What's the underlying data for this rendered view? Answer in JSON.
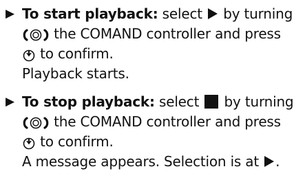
{
  "bullet_glyph": "▶",
  "items": [
    {
      "heading": "To start playback:",
      "text_a": " select ",
      "text_b": " by turning",
      "line2": " the COMAND controller and press",
      "line3": " to confirm.",
      "result": "Playback starts."
    },
    {
      "heading": "To stop playback:",
      "text_a": " select ",
      "text_b": " by turning",
      "line2": " the COMAND controller and press",
      "line3": " to confirm.",
      "result_a": "A message appears. Selection is at ",
      "result_b": "."
    }
  ],
  "icons": {
    "turn": "rotary-turn-icon",
    "press": "press-confirm-icon",
    "play": "play-symbol-icon",
    "stop": "stop-symbol-icon"
  }
}
